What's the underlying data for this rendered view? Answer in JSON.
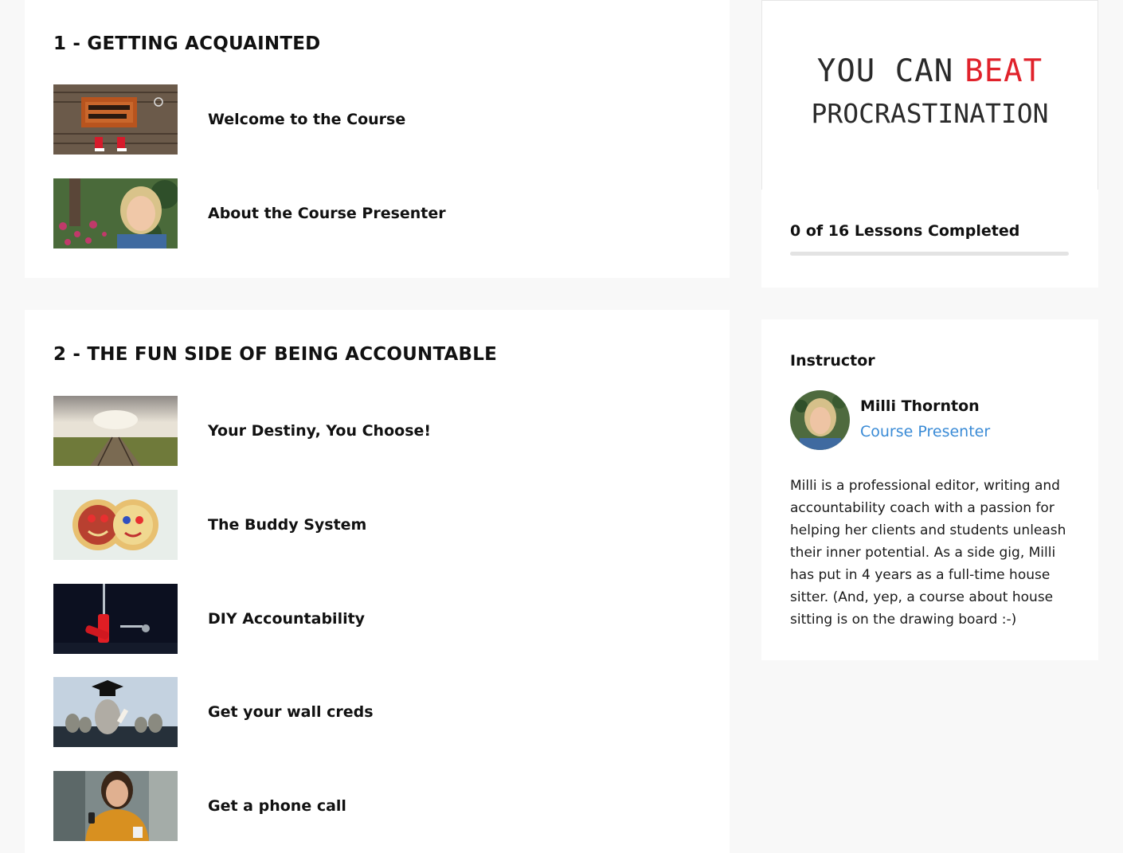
{
  "sections": [
    {
      "title": "1 - GETTING ACQUAINTED",
      "lessons": [
        {
          "title": "Welcome to the Course",
          "thumb": "welcome-doormat-image"
        },
        {
          "title": "About the Course Presenter",
          "thumb": "presenter-portrait-image"
        }
      ]
    },
    {
      "title": "2 - THE FUN SIDE OF BEING ACCOUNTABLE",
      "lessons": [
        {
          "title": "Your Destiny, You Choose!",
          "thumb": "railroad-field-image"
        },
        {
          "title": "The Buddy System",
          "thumb": "smiley-cookies-image"
        },
        {
          "title": "DIY Accountability",
          "thumb": "screwdrivers-image"
        },
        {
          "title": "Get your wall creds",
          "thumb": "graduation-stones-image"
        },
        {
          "title": "Get a phone call",
          "thumb": "woman-phone-image"
        }
      ]
    }
  ],
  "course_logo": {
    "line1_part1": "YOU CAN",
    "line1_part2": "BEAT",
    "line2": "PROCRASTINATION",
    "accent_color": "#e0222b"
  },
  "progress": {
    "text": "0 of 16 Lessons Completed",
    "completed": 0,
    "total": 16
  },
  "instructor": {
    "heading": "Instructor",
    "name": "Milli Thornton",
    "role": "Course Presenter",
    "bio": "Milli is a professional editor, writing and accountability coach with a passion for helping her clients and students unleash their inner potential. As a side gig, Milli has put in 4 years as a full-time house sitter. (And, yep, a course about house sitting is on the drawing board :-)"
  },
  "colors": {
    "link": "#3a8bd6",
    "page_bg": "#f8f8f8"
  }
}
